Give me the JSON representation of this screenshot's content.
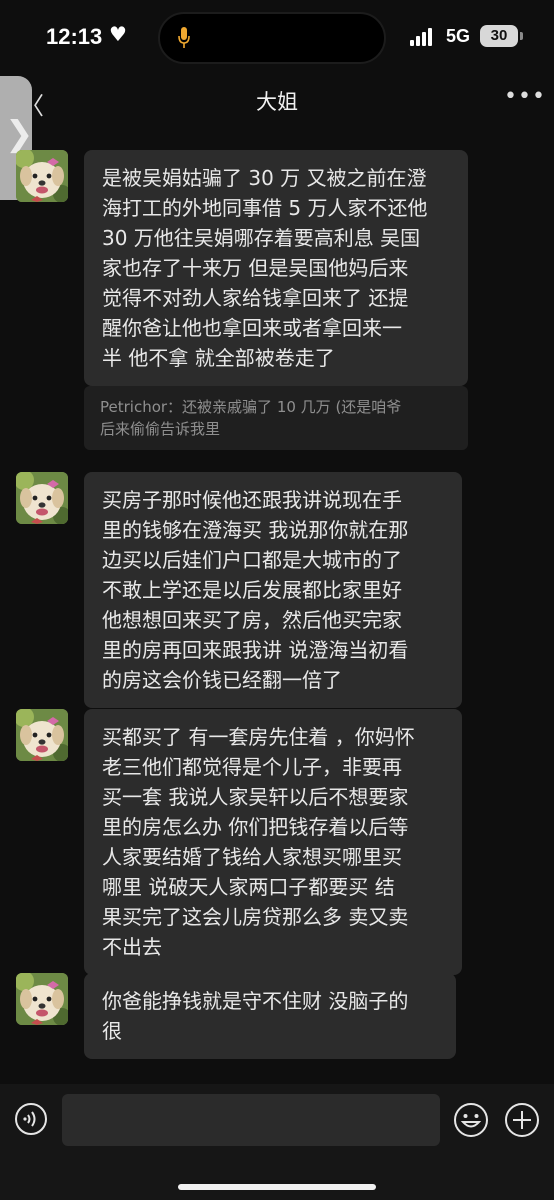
{
  "status_bar": {
    "time": "12:13",
    "heart": "♥",
    "network": "5G",
    "battery": "30"
  },
  "nav": {
    "back": "〈",
    "title": "大姐",
    "more": "•••"
  },
  "side_tab": {
    "label": "❯"
  },
  "messages": [
    {
      "sender_avatar": "dog-avatar",
      "lines": [
        "是被吴娟姑骗了 30 万 又被之前在澄",
        "海打工的外地同事借 5 万人家不还他",
        "30 万他往吴娟哪存着要高利息  吴国",
        "家也存了十来万 但是吴国他妈后来",
        "觉得不对劲人家给钱拿回来了  还提",
        "醒你爸让他也拿回来或者拿回来一",
        "半 他不拿  就全部被卷走了"
      ],
      "quote_lines": [
        "Petrichor：还被亲戚骗了 10 几万 (还是咱爷",
        "后来偷偷告诉我里"
      ]
    },
    {
      "sender_avatar": "dog-avatar",
      "lines": [
        "买房子那时候他还跟我讲说现在手",
        "里的钱够在澄海买  我说那你就在那",
        "边买以后娃们户口都是大城市的了",
        "不敢上学还是以后发展都比家里好",
        "他想想回来买了房，然后他买完家",
        "里的房再回来跟我讲  说澄海当初看",
        "的房这会价钱已经翻一倍了"
      ]
    },
    {
      "sender_avatar": "dog-avatar",
      "lines": [
        "买都买了  有一套房先住着 ，你妈怀",
        "老三他们都觉得是个儿子，非要再",
        "买一套  我说人家吴轩以后不想要家",
        "里的房怎么办  你们把钱存着以后等",
        "人家要结婚了钱给人家想买哪里买",
        "哪里   说破天人家两口子都要买  结",
        "果买完了这会儿房贷那么多  卖又卖",
        "不出去"
      ]
    },
    {
      "sender_avatar": "dog-avatar",
      "lines": [
        "你爸能挣钱就是守不住财  没脑子的",
        "很"
      ]
    }
  ],
  "input_bar": {
    "voice_icon": "voice-icon",
    "emoji_icon": "emoji-icon",
    "plus_icon": "plus-icon"
  }
}
